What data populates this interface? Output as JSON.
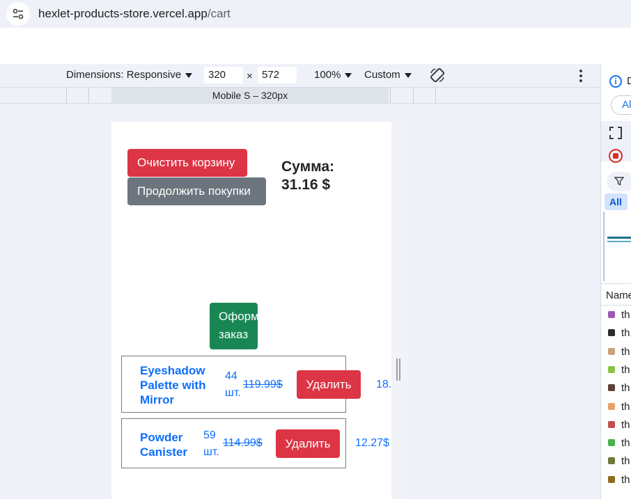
{
  "browser": {
    "url_host": "hexlet-products-store.vercel.app",
    "url_path": "/cart",
    "site_icon": "tune-icon"
  },
  "device_toolbar": {
    "dimensions_label": "Dimensions: Responsive",
    "width": "320",
    "times": "×",
    "height": "572",
    "zoom": "100%",
    "throttle": "Custom",
    "rotate_icon": "rotate-icon",
    "more_icon": "more-vert-icon",
    "media_query_label": "Mobile S – 320px"
  },
  "cart": {
    "clear_button": "Очистить корзину",
    "continue_button": "Продолжить покупки",
    "sum_label": "Сумма:",
    "sum_value": "31.16 $",
    "order_line1": "Оформить",
    "order_line2": "заказ",
    "items": [
      {
        "name_lines": [
          "Eyeshadow",
          "Palette with",
          "Mirror"
        ],
        "qty_line1": "44",
        "qty_line2": "шт.",
        "old_price": "119.99$",
        "delete_label": "Удалить",
        "new_price": "18.",
        "color_thumb": "#7b5ea7"
      },
      {
        "name_lines": [
          "Powder",
          "Canister"
        ],
        "qty_line1": "59",
        "qty_line2": "шт.",
        "old_price": "114.99$",
        "delete_label": "Удалить",
        "new_price": "12.27$"
      }
    ]
  },
  "devtools": {
    "info_letter": "D",
    "pill_text": "Al",
    "filter_icon": "filter-icon",
    "all_label": "All",
    "name_header": "Name",
    "rows": [
      {
        "text": "th",
        "color": "#9b59b6"
      },
      {
        "text": "th",
        "color": "#2c2c2c"
      },
      {
        "text": "th",
        "color": "#c8a27a"
      },
      {
        "text": "th",
        "color": "#8bc34a"
      },
      {
        "text": "th",
        "color": "#5d4037"
      },
      {
        "text": "th",
        "color": "#e8a06a"
      },
      {
        "text": "th",
        "color": "#c0504d"
      },
      {
        "text": "th",
        "color": "#4caf50"
      },
      {
        "text": "th",
        "color": "#6d7b3a"
      },
      {
        "text": "th",
        "color": "#8d6e1f"
      }
    ]
  },
  "colors": {
    "danger": "#dc3545",
    "secondary": "#6c757d",
    "success": "#198754",
    "link": "#0d6efd",
    "chrome_bg": "#eef1f8"
  }
}
